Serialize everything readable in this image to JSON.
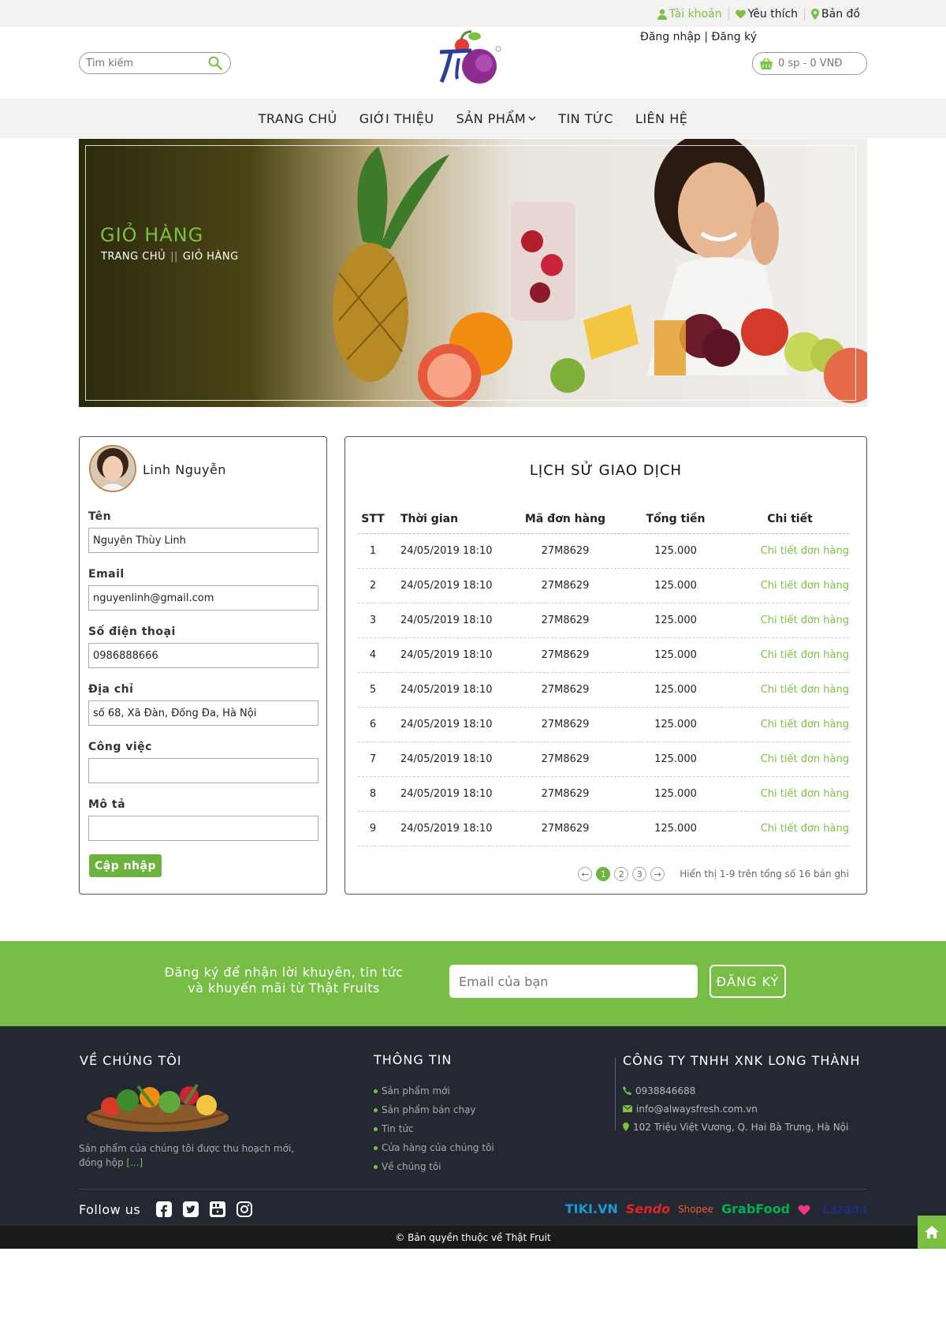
{
  "topbar": {
    "account": "Tài khoản",
    "favorites": "Yêu thích",
    "map": "Bản đồ",
    "login": "Đăng nhập",
    "separator": "|",
    "register": "Đăng ký"
  },
  "header": {
    "search_placeholder": "Tìm kiếm",
    "logo_text": "Thật",
    "cart_text": "0 sp - 0 VNĐ"
  },
  "nav": {
    "items": [
      "TRANG CHỦ",
      "GIỚI THIỆU",
      "SẢN PHẨM",
      "TIN TỨC",
      "LIÊN HỆ"
    ]
  },
  "banner": {
    "title": "GIỎ HÀNG",
    "crumb_home": "TRANG CHỦ",
    "crumb_sep": "||",
    "crumb_current": "GIỎ HÀNG"
  },
  "profile": {
    "name": "Linh Nguyễn",
    "fields": [
      {
        "label": "Tên",
        "value": "Nguyễn Thùy Linh"
      },
      {
        "label": "Email",
        "value": "nguyenlinh@gmail.com"
      },
      {
        "label": "Số điện thoại",
        "value": "0986888666"
      },
      {
        "label": "Địa chỉ",
        "value": "số 68, Xã Đàn, Đống Đa, Hà Nội"
      },
      {
        "label": "Công việc",
        "value": ""
      },
      {
        "label": "Mô tả",
        "value": ""
      }
    ],
    "update_button": "Cập nhập"
  },
  "transactions": {
    "title": "LỊCH SỬ GIAO DỊCH",
    "columns": [
      "STT",
      "Thời gian",
      "Mã đơn hàng",
      "Tổng tiền",
      "Chi tiết"
    ],
    "rows": [
      [
        "1",
        "24/05/2019 18:10",
        "27M8629",
        "125.000",
        "Chi tiết đơn hàng"
      ],
      [
        "2",
        "24/05/2019 18:10",
        "27M8629",
        "125.000",
        "Chi tiết đơn hàng"
      ],
      [
        "3",
        "24/05/2019 18:10",
        "27M8629",
        "125.000",
        "Chi tiết đơn hàng"
      ],
      [
        "4",
        "24/05/2019 18:10",
        "27M8629",
        "125.000",
        "Chi tiết đơn hàng"
      ],
      [
        "5",
        "24/05/2019 18:10",
        "27M8629",
        "125.000",
        "Chi tiết đơn hàng"
      ],
      [
        "6",
        "24/05/2019 18:10",
        "27M8629",
        "125.000",
        "Chi tiết đơn hàng"
      ],
      [
        "7",
        "24/05/2019 18:10",
        "27M8629",
        "125.000",
        "Chi tiết đơn hàng"
      ],
      [
        "8",
        "24/05/2019 18:10",
        "27M8629",
        "125.000",
        "Chi tiết đơn hàng"
      ],
      [
        "9",
        "24/05/2019 18:10",
        "27M8629",
        "125.000",
        "Chi tiết đơn hàng"
      ]
    ],
    "pagination": {
      "prev": "←",
      "pages": [
        "1",
        "2",
        "3"
      ],
      "current": "1",
      "next": "→",
      "info": "Hiển thị 1-9 trên tổng số 16 bản ghi"
    }
  },
  "newsletter": {
    "text_line1": "Đăng ký để nhận lời khuyên, tin tức",
    "text_line2": "và khuyến mãi từ Thật Fruits",
    "input_placeholder": "Email của bạn",
    "button": "ĐĂNG KÝ"
  },
  "footer": {
    "about_title": "VỀ CHÚNG TÔI",
    "about_text": "Sản phẩm của chúng tôi được thu hoạch mới, đóng hộp",
    "about_more": "[...]",
    "info_title": "THÔNG TIN",
    "info_links": [
      "Sản phẩm mới",
      "Sản phẩm bán chạy",
      "Tin tức",
      "Cửa hàng của chúng tôi",
      "Về chúng tôi"
    ],
    "company_title": "CÔNG TY TNHH XNK LONG THÀNH",
    "phone": "0938846688",
    "email": "info@alwaysfresh.com.vn",
    "address": "102 Triệu Việt Vương, Q. Hai Bà Trưng, Hà Nội",
    "follow_label": "Follow us",
    "partners": [
      "TIKI.VN",
      "Sendo",
      "Shopee",
      "GrabFood",
      "Lazada"
    ],
    "copyright": "© Bản quyền thuộc về Thật Fruit"
  },
  "colors": {
    "accent": "#7bc043",
    "footer_bg": "#232833",
    "newsletter_bg": "#78bd45"
  }
}
